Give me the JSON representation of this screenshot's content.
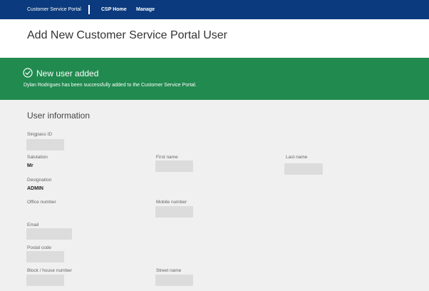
{
  "header": {
    "brand": "Customer Service Portal",
    "nav": [
      "CSP Home",
      "Manage"
    ]
  },
  "page": {
    "title": "Add New Customer Service Portal User"
  },
  "alert": {
    "title": "New user added",
    "message": "Dylan Rodrigues has been successfully added to the Customer Service Portal."
  },
  "section": {
    "title": "User information"
  },
  "fields": {
    "singpass_id": {
      "label": "Singpass ID"
    },
    "salutation": {
      "label": "Salutation",
      "value": "Mr"
    },
    "first_name": {
      "label": "First name"
    },
    "last_name": {
      "label": "Last name"
    },
    "designation": {
      "label": "Designation",
      "value": "ADMIN"
    },
    "office_number": {
      "label": "Office number"
    },
    "mobile_number": {
      "label": "Mobile number"
    },
    "email": {
      "label": "Email"
    },
    "postal_code": {
      "label": "Postal code"
    },
    "block_house_number": {
      "label": "Block / house number"
    },
    "street_name": {
      "label": "Street name"
    }
  },
  "colors": {
    "header_bg": "#0b3a7e",
    "success_bg": "#218a4f",
    "page_bg": "#f0f0f0",
    "placeholder_bg": "#dcdcdc"
  },
  "icons": {
    "alert": "check-circle-icon"
  }
}
